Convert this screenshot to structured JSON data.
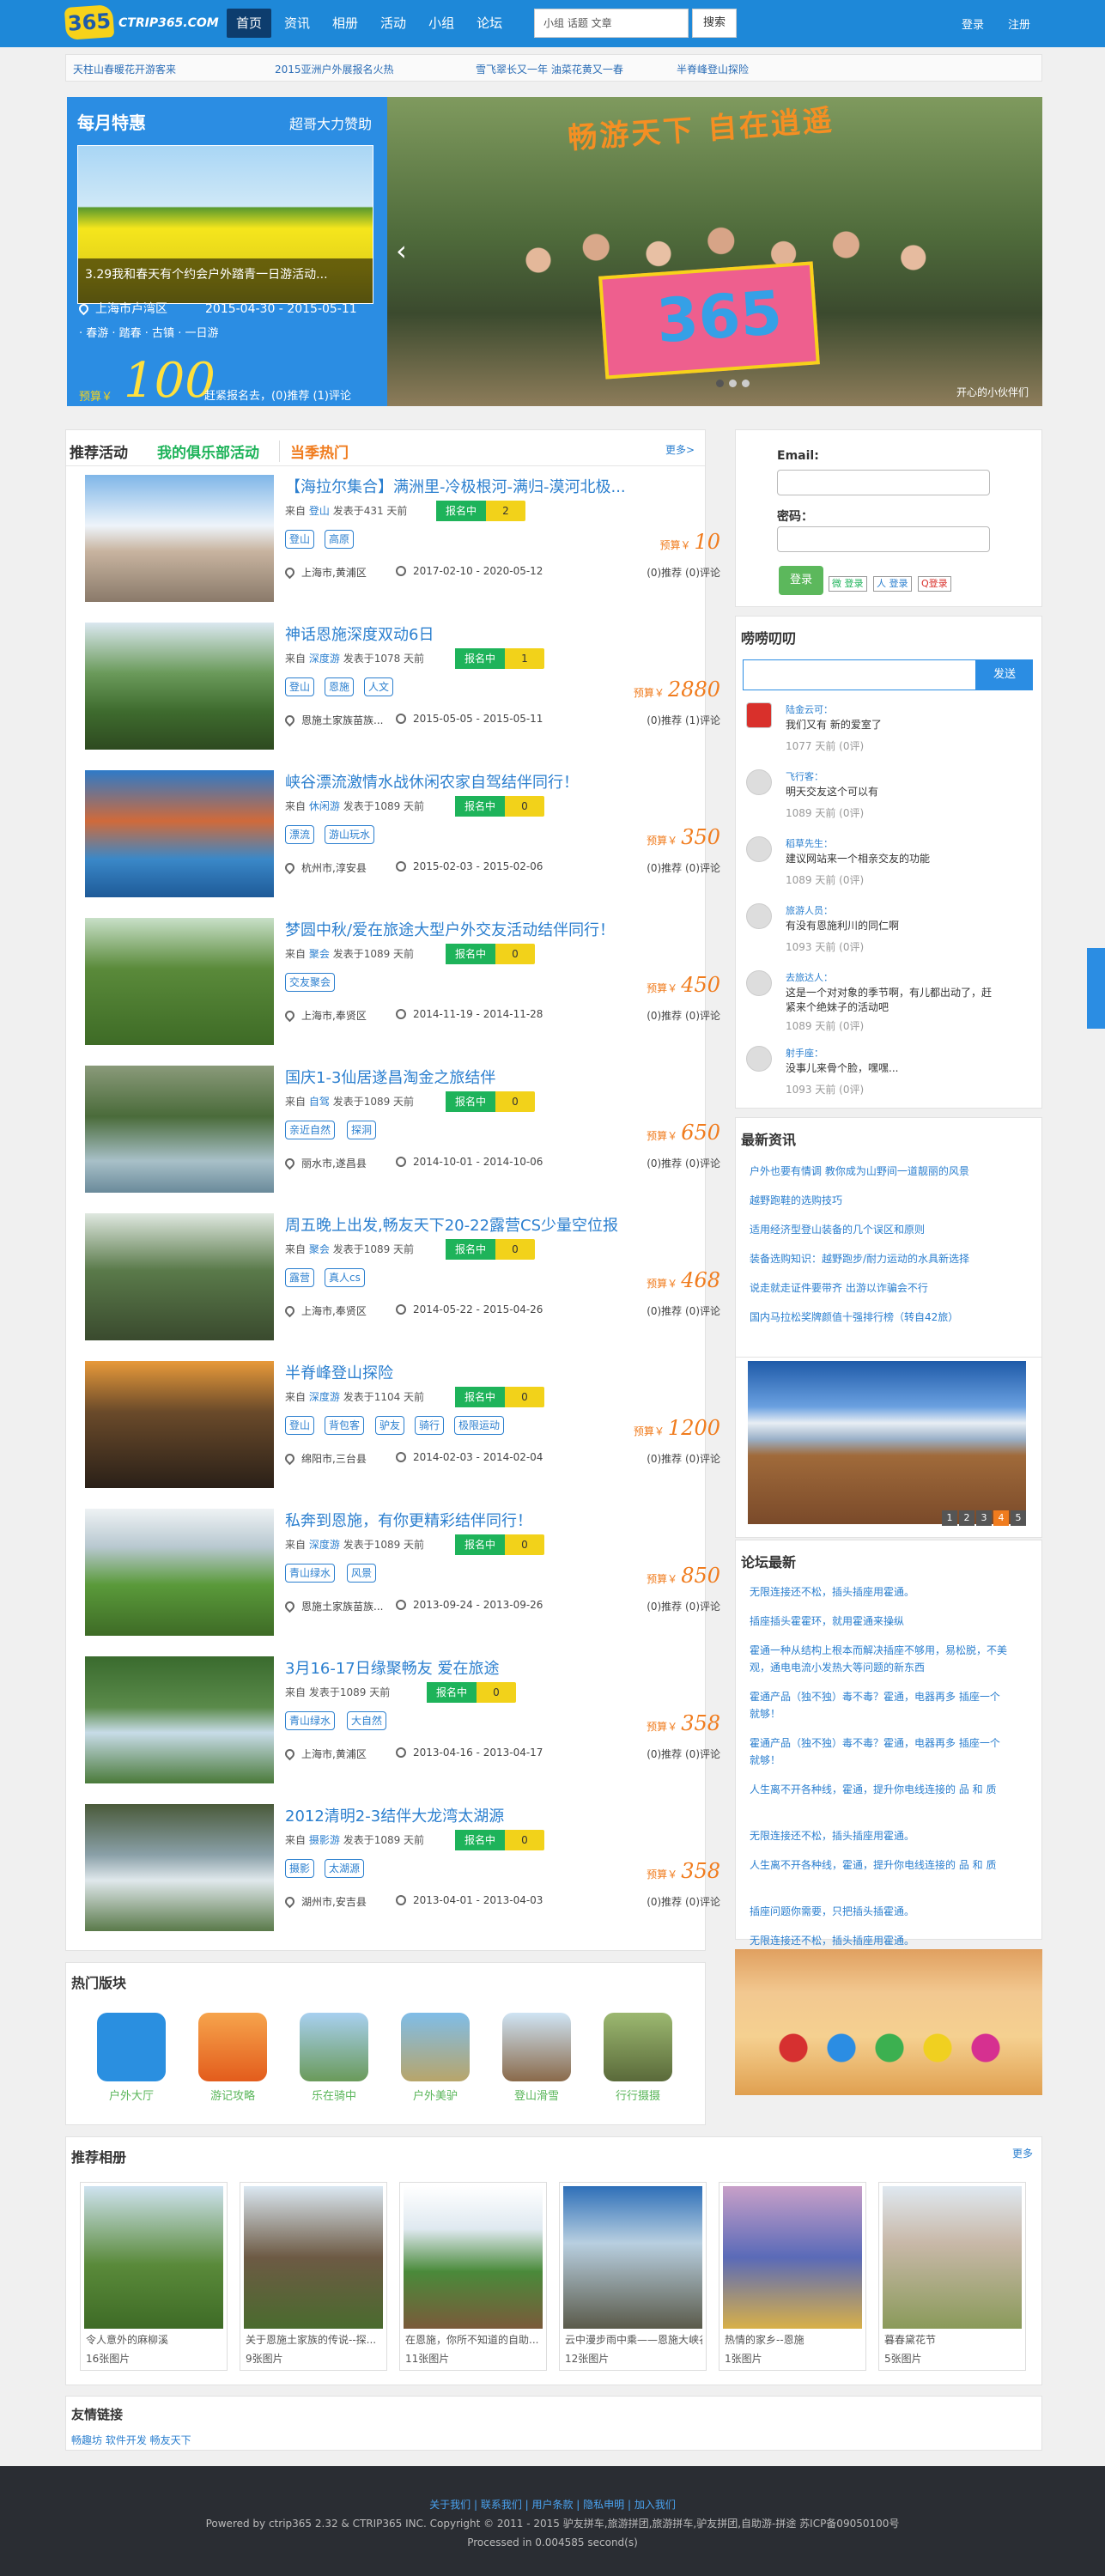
{
  "header": {
    "logo_mark": "365",
    "logo_text": "CTRIP365.COM",
    "nav": [
      "首页",
      "资讯",
      "相册",
      "活动",
      "小组",
      "论坛"
    ],
    "search_placeholder": "小组 话题 文章",
    "search_btn": "搜索",
    "login": "登录",
    "register": "注册"
  },
  "ticker": [
    "天柱山春暖花开游客来",
    "2015亚洲户外展报名火热",
    "雪飞翠长又一年 油菜花黄又一春",
    "半脊峰登山探险"
  ],
  "deal": {
    "title": "每月特惠",
    "sub": "超哥大力赞助",
    "caption": "3.29我和春天有个约会户外踏青一日游活动...",
    "location": "上海市卢湾区",
    "dates": "2015-04-30 - 2015-05-11",
    "tags": "· 春游 · 踏春 · 古镇 · 一日游",
    "budget_label": "预算￥",
    "price": "100",
    "rest": "赶紧报名去，(0)推荐 (1)评论"
  },
  "hero": {
    "title": "畅游天下 自在逍遥",
    "banner": "365",
    "caption": "开心的小伙伴们"
  },
  "tabs": [
    "推荐活动",
    "我的俱乐部活动",
    "当季热门"
  ],
  "more": "更多>",
  "activities": [
    {
      "title": "【海拉尔集合】满洲里-冷极根河-满归-漠河北极...",
      "from": "来自",
      "cat": "登山",
      "post": "发表于431 天前",
      "status": "报名中",
      "count": "2",
      "tags": [
        "登山",
        "高原"
      ],
      "budget_label": "预算￥",
      "price": "10",
      "loc": "上海市,黄浦区",
      "date": "2017-02-10 - 2020-05-12",
      "rec": "(0)推荐 (0)评论"
    },
    {
      "title": "神话恩施深度双动6日",
      "from": "来自",
      "cat": "深度游",
      "post": "发表于1078 天前",
      "status": "报名中",
      "count": "1",
      "tags": [
        "登山",
        "恩施",
        "人文"
      ],
      "budget_label": "预算￥",
      "price": "2880",
      "loc": "恩施土家族苗族...",
      "date": "2015-05-05 - 2015-05-11",
      "rec": "(0)推荐 (1)评论"
    },
    {
      "title": "峡谷漂流激情水战休闲农家自驾结伴同行！",
      "from": "来自",
      "cat": "休闲游",
      "post": "发表于1089 天前",
      "status": "报名中",
      "count": "0",
      "tags": [
        "漂流",
        "游山玩水"
      ],
      "budget_label": "预算￥",
      "price": "350",
      "loc": "杭州市,淳安县",
      "date": "2015-02-03 - 2015-02-06",
      "rec": "(0)推荐 (0)评论"
    },
    {
      "title": "梦圆中秋/爱在旅途大型户外交友活动结伴同行！",
      "from": "来自",
      "cat": "聚会",
      "post": "发表于1089 天前",
      "status": "报名中",
      "count": "0",
      "tags": [
        "交友聚会"
      ],
      "budget_label": "预算￥",
      "price": "450",
      "loc": "上海市,奉贤区",
      "date": "2014-11-19 - 2014-11-28",
      "rec": "(0)推荐 (0)评论"
    },
    {
      "title": "国庆1-3仙居遂昌淘金之旅结伴",
      "from": "来自",
      "cat": "自驾",
      "post": "发表于1089 天前",
      "status": "报名中",
      "count": "0",
      "tags": [
        "亲近自然",
        "探洞"
      ],
      "budget_label": "预算￥",
      "price": "650",
      "loc": "丽水市,遂昌县",
      "date": "2014-10-01 - 2014-10-06",
      "rec": "(0)推荐 (0)评论"
    },
    {
      "title": "周五晚上出发,畅友天下20-22露营CS少量空位报",
      "from": "来自",
      "cat": "聚会",
      "post": "发表于1089 天前",
      "status": "报名中",
      "count": "0",
      "tags": [
        "露营",
        "真人cs"
      ],
      "budget_label": "预算￥",
      "price": "468",
      "loc": "上海市,奉贤区",
      "date": "2014-05-22 - 2015-04-26",
      "rec": "(0)推荐 (0)评论"
    },
    {
      "title": "半脊峰登山探险",
      "from": "来自",
      "cat": "深度游",
      "post": "发表于1104 天前",
      "status": "报名中",
      "count": "0",
      "tags": [
        "登山",
        "背包客",
        "驴友",
        "骑行",
        "极限运动"
      ],
      "budget_label": "预算￥",
      "price": "1200",
      "loc": "绵阳市,三台县",
      "date": "2014-02-03 - 2014-02-04",
      "rec": "(0)推荐 (0)评论"
    },
    {
      "title": "私奔到恩施，有你更精彩结伴同行！",
      "from": "来自",
      "cat": "深度游",
      "post": "发表于1089 天前",
      "status": "报名中",
      "count": "0",
      "tags": [
        "青山绿水",
        "风景"
      ],
      "budget_label": "预算￥",
      "price": "850",
      "loc": "恩施土家族苗族...",
      "date": "2013-09-24 - 2013-09-26",
      "rec": "(0)推荐 (0)评论"
    },
    {
      "title": "3月16-17日缘聚畅友 爱在旅途",
      "from": "来自",
      "cat": "",
      "post": "发表于1089 天前",
      "status": "报名中",
      "count": "0",
      "tags": [
        "青山绿水",
        "大自然"
      ],
      "budget_label": "预算￥",
      "price": "358",
      "loc": "上海市,黄浦区",
      "date": "2013-04-16 - 2013-04-17",
      "rec": "(0)推荐 (0)评论"
    },
    {
      "title": "2012清明2-3结伴大龙湾太湖源",
      "from": "来自",
      "cat": "摄影游",
      "post": "发表于1089 天前",
      "status": "报名中",
      "count": "0",
      "tags": [
        "摄影",
        "太湖源"
      ],
      "budget_label": "预算￥",
      "price": "358",
      "loc": "湖州市,安吉县",
      "date": "2013-04-01 - 2013-04-03",
      "rec": "(0)推荐 (0)评论"
    }
  ],
  "hot": {
    "title": "热门版块",
    "items": [
      "户外大厅",
      "游记攻略",
      "乐在骑中",
      "户外美驴",
      "登山滑雪",
      "行行摄摄"
    ]
  },
  "albums": {
    "title": "推荐相册",
    "more": "更多",
    "items": [
      {
        "name": "令人意外的麻柳溪",
        "count": "16张图片"
      },
      {
        "name": "关于恩施土家族的传说--探...",
        "count": "9张图片"
      },
      {
        "name": "在恩施，你所不知道的自助...",
        "count": "11张图片"
      },
      {
        "name": "云中漫步雨中乘——恩施大峡谷",
        "count": "12张图片"
      },
      {
        "name": "热情的家乡--恩施",
        "count": "1张图片"
      },
      {
        "name": "暮春黛花节",
        "count": "5张图片"
      }
    ]
  },
  "links": {
    "title": "友情链接",
    "text": "畅趣坊 软件开发 畅友天下"
  },
  "login": {
    "email": "Email:",
    "password": "密码：",
    "btn": "登录",
    "soc": [
      "微 登录",
      "人 登录",
      "Q登录"
    ]
  },
  "chatter": {
    "title": "唠唠叨叨",
    "send": "发送",
    "items": [
      {
        "name": "陆金云可：",
        "text": "我们又有 新的爱室了",
        "time": "1077 天前 (0评)"
      },
      {
        "name": "飞行客：",
        "text": "明天交友这个可以有",
        "time": "1089 天前 (0评)"
      },
      {
        "name": "稻草先生：",
        "text": "建议网站来一个相亲交友的功能",
        "time": "1089 天前 (0评)"
      },
      {
        "name": "旅游人员：",
        "text": "有没有恩施利川的同仁啊",
        "time": "1093 天前 (0评)"
      },
      {
        "name": "去旅达人：",
        "text": "这是一个对对象的季节啊，有儿都出动了，赶紧来个绝妹子的活动吧",
        "time": "1089 天前 (0评)"
      },
      {
        "name": "射手座：",
        "text": "没事儿来骨个脸，嘿嘿...",
        "time": "1093 天前 (0评)"
      }
    ]
  },
  "latest": {
    "title": "最新资讯",
    "items": [
      "户外也要有情调 教你成为山野间一道靓丽的风景",
      "越野跑鞋的选购技巧",
      "适用经济型登山装备的几个误区和原则",
      "装备选购知识：越野跑步/耐力运动的水具新选择",
      "说走就走证件要带齐 出游以诈骗会不行",
      "国内马拉松奖牌颜值十强排行榜（转自42旅）"
    ]
  },
  "carousel": [
    "1",
    "2",
    "3",
    "4",
    "5"
  ],
  "forum": {
    "title": "论坛最新",
    "items": [
      "无限连接还不松，插头插座用霍通。",
      "插座插头霍霍环，就用霍通来操纵",
      "霍通一种从结构上根本而解决插座不够用，易松脱，不美观，通电电流小发热大等问题的新东西",
      "霍通产品（独不独）毒不毒？霍通，电器再多 插座一个就够！",
      "霍通产品（独不独）毒不毒？霍通，电器再多 插座一个就够！",
      "人生离不开各种线，霍通，提升你电线连接的 品 和 质",
      "无限连接还不松，插头插座用霍通。",
      "人生离不开各种线，霍通，提升你电线连接的 品 和 质",
      "插座问题你需要，只把插头插霍通。",
      "无限连接还不松，插头插座用霍通。"
    ]
  },
  "footer": {
    "links": "关于我们 | 联系我们 | 用户条款 | 隐私申明 | 加入我们",
    "powered": "Powered by ctrip365 2.32 & CTRIP365 INC. Copyright © 2011 - 2015 驴友拼车,旅游拼团,旅游拼车,驴友拼团,自助游-拼途 苏ICP备09050100号",
    "proc": "Processed in 0.004585 second(s)"
  }
}
